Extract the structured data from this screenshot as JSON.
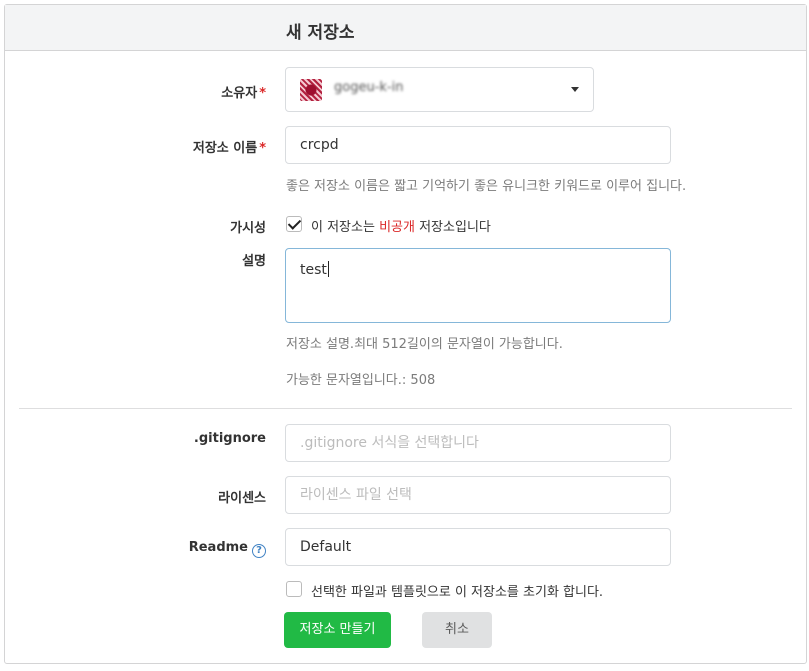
{
  "form": {
    "title": "새 저장소",
    "owner": {
      "label": "소유자",
      "required_mark": "*",
      "value": "gogeu-k-in"
    },
    "repo_name": {
      "label": "저장소 이름",
      "required_mark": "*",
      "value": "crcpd",
      "hint": "좋은 저장소 이름은 짧고 기억하기 좋은 유니크한 키워드로 이루어 집니다."
    },
    "visibility": {
      "label": "가시성",
      "checked": true,
      "text_before": "이 저장소는 ",
      "text_highlight": "비공개",
      "text_after": " 저장소입니다"
    },
    "description": {
      "label": "설명",
      "value": "test",
      "hint": "저장소 설명.최대 512길이의 문자열이 가능합니다.",
      "remaining": "가능한 문자열입니다.: 508"
    },
    "gitignore": {
      "label": ".gitignore",
      "placeholder": ".gitignore 서식을 선택합니다"
    },
    "license": {
      "label": "라이센스",
      "placeholder": "라이센스 파일 선택"
    },
    "readme": {
      "label": "Readme",
      "help_icon": "question-circle-icon",
      "value": "Default"
    },
    "init_checkbox": {
      "checked": false,
      "text": "선택한 파일과 템플릿으로 이 저장소를 초기화 합니다."
    },
    "create_button": "저장소 만들기",
    "cancel_button": "취소"
  },
  "colors": {
    "primary_green": "#21ba45",
    "required_red": "#db2828",
    "focus_border": "#85b7d9"
  }
}
